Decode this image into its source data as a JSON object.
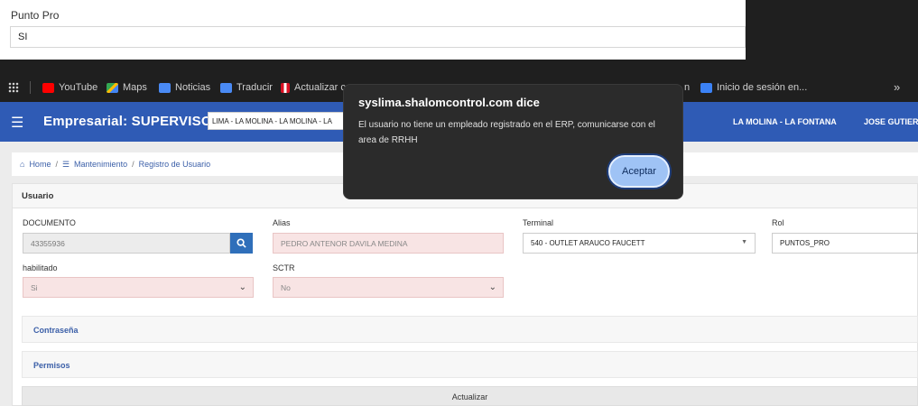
{
  "top_panel": {
    "label": "Punto Pro",
    "value": "SI"
  },
  "bookmarks": [
    {
      "label": "YouTube",
      "icon": "youtube-icon",
      "color": "#ff0000"
    },
    {
      "label": "Maps",
      "icon": "maps-icon",
      "color": "#34a853"
    },
    {
      "label": "Noticias",
      "icon": "news-icon",
      "color": "#4a8af4"
    },
    {
      "label": "Traducir",
      "icon": "translate-icon",
      "color": "#4a8af4"
    },
    {
      "label": "Actualizar c",
      "icon": "peru-flag-icon",
      "color": "#d91023"
    },
    {
      "label": "n",
      "icon": "",
      "color": ""
    },
    {
      "label": "Inicio de sesión en...",
      "icon": "zoho-icon",
      "color": "#3b82f6"
    },
    {
      "label": "»",
      "icon": "",
      "color": ""
    }
  ],
  "header": {
    "title": "Empresarial: SUPERVISORES",
    "branch_select": "LIMA - LA MOLINA - LA MOLINA - LA",
    "branch": "LA MOLINA - LA FONTANA",
    "user": "JOSE GUTIERR",
    "color": "#2f5bb5"
  },
  "breadcrumb": {
    "home": "Home",
    "section": "Mantenimiento",
    "page": "Registro de Usuario"
  },
  "card": {
    "title": "Usuario",
    "documento": {
      "label": "DOCUMENTO",
      "value": "43355936"
    },
    "alias": {
      "label": "Alias",
      "value": "PEDRO ANTENOR DAVILA MEDINA"
    },
    "terminal": {
      "label": "Terminal",
      "value": "540 - OUTLET ARAUCO FAUCETT"
    },
    "rol": {
      "label": "Rol",
      "value": "PUNTOS_PRO"
    },
    "habilitado": {
      "label": "habilitado",
      "value": "Si"
    },
    "sctr": {
      "label": "SCTR",
      "value": "No"
    },
    "password_section": "Contraseña",
    "permissions_section": "Permisos",
    "update_label": "Actualizar"
  },
  "dialog": {
    "title": "syslima.shalomcontrol.com dice",
    "message": "El usuario no tiene un empleado registrado en el ERP, comunicarse con el area de RRHH",
    "button": "Aceptar"
  }
}
